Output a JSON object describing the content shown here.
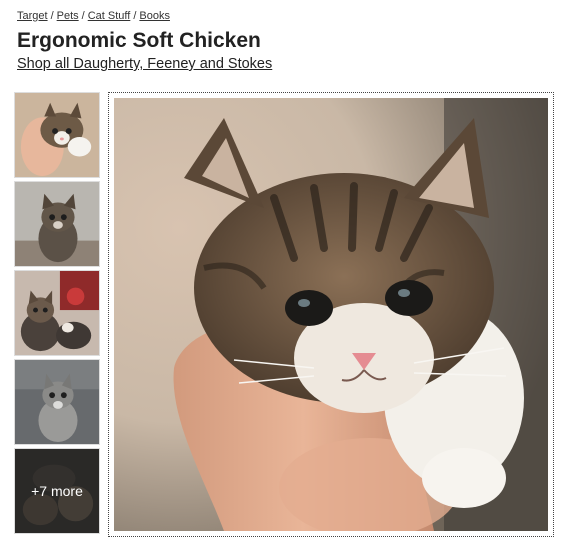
{
  "breadcrumb": {
    "items": [
      "Target",
      "Pets",
      "Cat Stuff",
      "Books"
    ],
    "separator": "/"
  },
  "product": {
    "title": "Ergonomic Soft Chicken",
    "brand_link": "Shop all Daugherty, Feeney and Stokes"
  },
  "gallery": {
    "thumbnails": [
      {
        "alt": "tabby-kitten-in-hand"
      },
      {
        "alt": "tabby-kitten-sitting"
      },
      {
        "alt": "kittens-with-red-toy"
      },
      {
        "alt": "grey-tabby-kitten"
      },
      {
        "alt": "more-kittens"
      }
    ],
    "more_label": "+7 more",
    "main_image": "tabby-kitten-in-hand"
  }
}
